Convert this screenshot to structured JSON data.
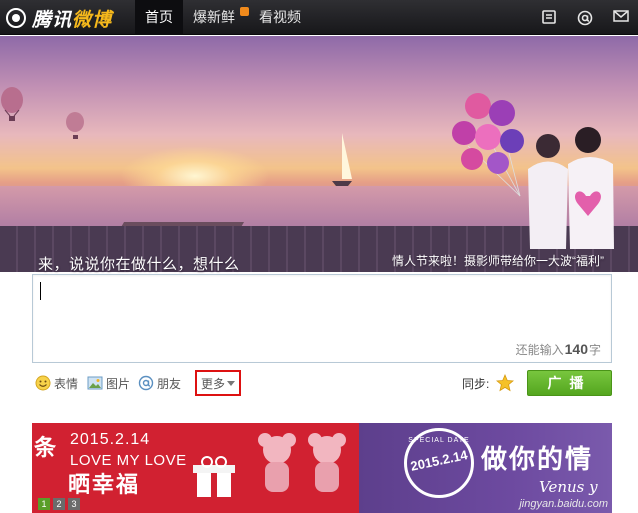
{
  "header": {
    "logo": {
      "text": "腾讯",
      "text_highlight": "微博",
      "icon": "tencent-logo-icon"
    },
    "nav": [
      {
        "label": "首页",
        "active": true
      },
      {
        "label": "爆新鲜",
        "badge": true
      },
      {
        "label": "看视频"
      }
    ],
    "icons": [
      "private-message-icon",
      "at-mention-icon",
      "mail-icon"
    ]
  },
  "banner": {
    "prompt": "来，说说你在做什么，想什么",
    "promo": "情人节来啦！摄影师带给你一大波“福利”"
  },
  "composer": {
    "value": "",
    "counter_prefix": "还能输入",
    "counter_value": "140",
    "counter_suffix": "字"
  },
  "toolbar": {
    "emoji_label": "表情",
    "image_label": "图片",
    "friend_label": "朋友",
    "more_label": "更多",
    "sync_label": "同步:",
    "publish_label": "广播"
  },
  "ad": {
    "left_char_top": "条",
    "date": "2015.2.14",
    "line1": "LOVE MY LOVE",
    "left_char_bottom": "晒",
    "line2": "晒幸福",
    "seal_top": "SPECIAL DATE",
    "seal_date": "2015.2.14",
    "headline": "做你的情",
    "sub": "Venus y",
    "pager": [
      "1",
      "2",
      "3"
    ],
    "watermark": "jingyan.baidu.com"
  },
  "colors": {
    "accent_green": "#5ab02a",
    "nav_bg": "#1f1f22",
    "highlight_red": "#d11111",
    "ad_red": "#d12131",
    "ad_purple": "#6a48a0"
  }
}
